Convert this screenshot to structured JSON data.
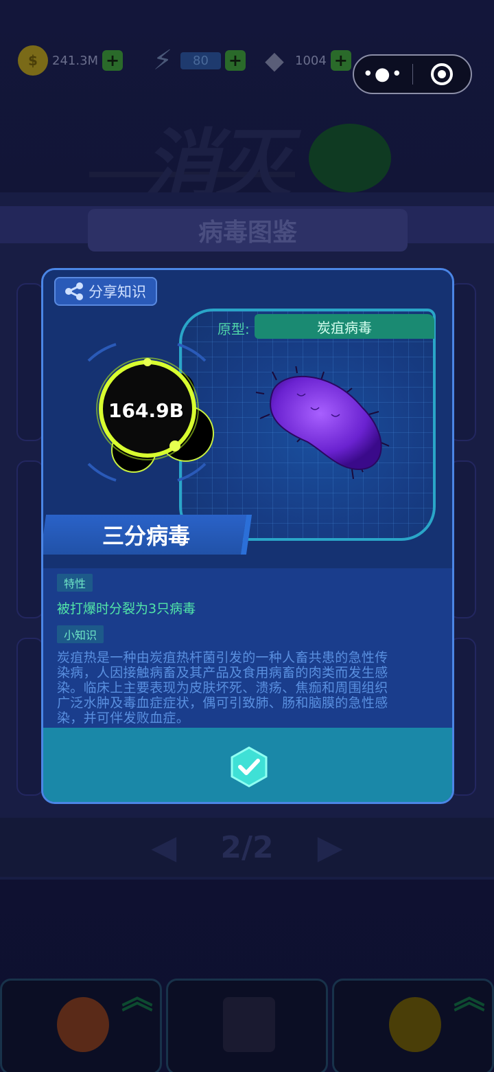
{
  "resources": {
    "coins": "241.3M",
    "energy": "80",
    "gems": "1004"
  },
  "capsule": {
    "menu_icon": "more-dots-icon",
    "close_icon": "record-icon"
  },
  "game_logo": "消灭",
  "page_title": "病毒图鉴",
  "modal": {
    "share_label": "分享知识",
    "prototype_label": "原型:",
    "prototype_name": "炭疽病毒",
    "virus_value": "164.9B",
    "virus_name": "三分病毒",
    "trait_tag": "特性",
    "trait_text": "被打爆时分裂为3只病毒",
    "knowledge_tag": "小知识",
    "knowledge_lines": [
      "炭疽热是一种由炭疽热杆菌引发的一种人畜共患的急性传",
      "染病，人因接触病畜及其产品及食用病畜的肉类而发生感",
      "染。临床上主要表现为皮肤坏死、溃疡、焦痂和周围组织",
      "广泛水肿及毒血症症状，偶可引致肺、肠和脑膜的急性感",
      "染，并可伴发败血症。"
    ]
  },
  "pager": {
    "label": "2/2"
  }
}
